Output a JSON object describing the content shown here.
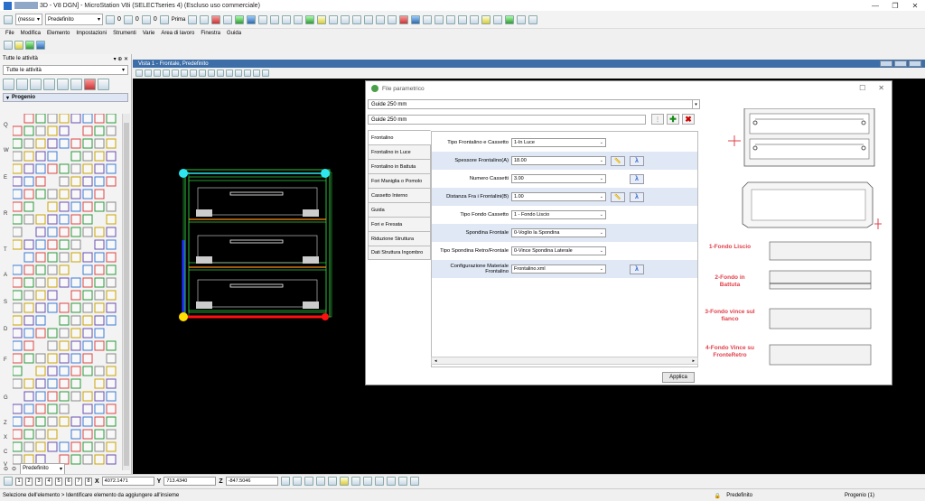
{
  "window": {
    "title": "3D - V8 DGN] - MicroStation V8i (SELECTseries 4) (Escluso uso commerciale)",
    "controls": [
      "—",
      "❐",
      "✕"
    ]
  },
  "toolbar": {
    "combo1": "(nessu",
    "combo2": "Predefinito",
    "count1": "0",
    "count2": "0",
    "count3": "0",
    "prima": "Prima"
  },
  "menu": [
    "File",
    "Modifica",
    "Elemento",
    "Impostazioni",
    "Strumenti",
    "Varie",
    "Area di lavoro",
    "Finestra",
    "Guida"
  ],
  "left_panel": {
    "header": "Tutte le attività",
    "header_ctl": "▾ ⊕ ✕",
    "combo": "Tutte le attività",
    "section": "Progenio",
    "letters": [
      "Q",
      "W",
      "E",
      "R",
      "T",
      "A",
      "S",
      "D",
      "F",
      "G",
      "Z",
      "X",
      "C",
      "V"
    ],
    "footer_combo": "Predefinito"
  },
  "view": {
    "title": "Vista 1 - Frontale, Predefinito"
  },
  "dialog": {
    "title": "File parametrico",
    "select_value": "Guide 250 mm",
    "name_value": "Guide 250 mm",
    "tabs": [
      "Frontalino",
      "Frontalino in Luce",
      "Frontalino in Battuta",
      "Fori Maniglia o Pomolo",
      "Cassetto Interno",
      "Guida",
      "Fori e Fresata",
      "Riduzione Struttura",
      "Dati Struttura Ingombro"
    ],
    "fields": [
      {
        "label": "Tipo Frontalino e Cassetto",
        "value": "1-In Luce",
        "ruler": false,
        "lambda": false
      },
      {
        "label": "Spessore Frontalino(A)",
        "value": "18.00",
        "ruler": true,
        "lambda": true
      },
      {
        "label": "Numero Cassetti",
        "value": "3.00",
        "ruler": false,
        "lambda": true
      },
      {
        "label": "Distanza Fra i Frontalini(B)",
        "value": "1.00",
        "ruler": true,
        "lambda": true
      },
      {
        "label": "Tipo Fondo Cassetto",
        "value": "1 - Fondo Liscio",
        "ruler": false,
        "lambda": false
      },
      {
        "label": "Spondina Frontale",
        "value": "0-Voglio la Spondina",
        "ruler": false,
        "lambda": false
      },
      {
        "label": "Tipo Spondina Retro/Frontale",
        "value": "0-Vince Spondina Laterale",
        "ruler": false,
        "lambda": false
      },
      {
        "label": "Configurazione Materiale Frontalino",
        "value": "Frontalino.xml",
        "ruler": false,
        "lambda": true
      }
    ],
    "apply": "Applica",
    "preview_labels": [
      "1-Fondo Liscio",
      "2-Fondo in Battuta",
      "3-Fondo vince sul fianco",
      "4-Fondo Vince su FronteRetro"
    ]
  },
  "status": {
    "footer_combo": "Predefinito",
    "numbers": [
      "1",
      "2",
      "3",
      "4",
      "5",
      "6",
      "7",
      "8"
    ],
    "x_label": "X",
    "x_value": "4072.1471",
    "y_label": "Y",
    "y_value": "713.4340",
    "z_label": "Z",
    "z_value": "-847.5046",
    "message": "Selezione dell'elemento > Identificare elemento da aggiungere all'insieme",
    "level": "Predefinito",
    "model": "Progenio (1)"
  },
  "colors": {
    "view_bg": "#000000",
    "drawing_green": "#2fbf3a",
    "drawing_cyan": "#2ee6ef",
    "drawing_red": "#ff1010",
    "drawing_yellow": "#ffe000",
    "drawing_blue": "#2030ff",
    "drawing_orange": "#ff8c1a",
    "preview_label": "#e0404a"
  }
}
